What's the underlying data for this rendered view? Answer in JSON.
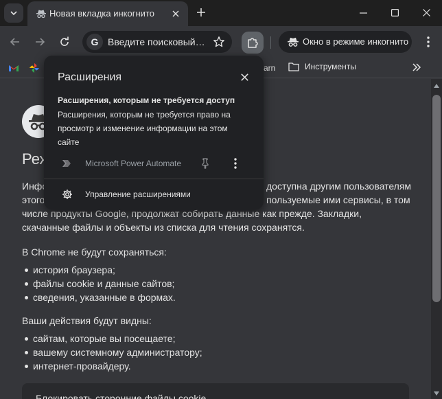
{
  "tab": {
    "title": "Новая вкладка инкогнито"
  },
  "omnibox": {
    "placeholder": "Введите поисковый…",
    "engine_logo": "G"
  },
  "incognito_chip": {
    "label": "Окно в режиме инкогнито"
  },
  "bookmarks": {
    "truncated_label": "arn",
    "folder_label": "Инструменты"
  },
  "page": {
    "heading": "Реж",
    "para1_lines": [
      "Инфо",
      "этого",
      "числе продукты Google, продолжат собирать данные как прежде. Закладки,",
      "скачанные файлы и объекты из списка для чтения сохранятся."
    ],
    "para1_right_lines": [
      "доступна другим пользователям",
      "пользуемые ими сервисы, в том"
    ],
    "not_saved_title": "В Chrome не будут сохраняться:",
    "not_saved_items": [
      "история браузера;",
      "файлы cookie и данные сайтов;",
      "сведения, указанные в формах."
    ],
    "visible_title": "Ваши действия будут видны:",
    "visible_items": [
      "сайтам, которые вы посещаете;",
      "вашему системному администратору;",
      "интернет-провайдеру."
    ],
    "cookie_box_label": "Блокировать сторонние файлы cookie"
  },
  "popup": {
    "title": "Расширения",
    "section_title": "Расширения, которым не требуется доступ",
    "section_desc": "Расширения, которым не требуется право на просмотр и изменение информации на этом сайте",
    "extension_name": "Microsoft Power Automate",
    "manage_label": "Управление расширениями"
  },
  "colors": {
    "frame": "#1f1f1f",
    "toolbar": "#35363a",
    "popup": "#202124",
    "text": "#e3e3e3",
    "muted_text": "#9aa0a6"
  },
  "icons": [
    "tab-search-icon",
    "incognito-icon",
    "close-icon",
    "plus-icon",
    "minimize-icon",
    "maximize-icon",
    "back-icon",
    "forward-icon",
    "reload-icon",
    "star-icon",
    "puzzle-icon",
    "kebab-icon",
    "gmail-icon",
    "photos-icon",
    "folder-icon",
    "chevron-double-right-icon",
    "power-automate-icon",
    "pin-icon",
    "gear-icon"
  ]
}
